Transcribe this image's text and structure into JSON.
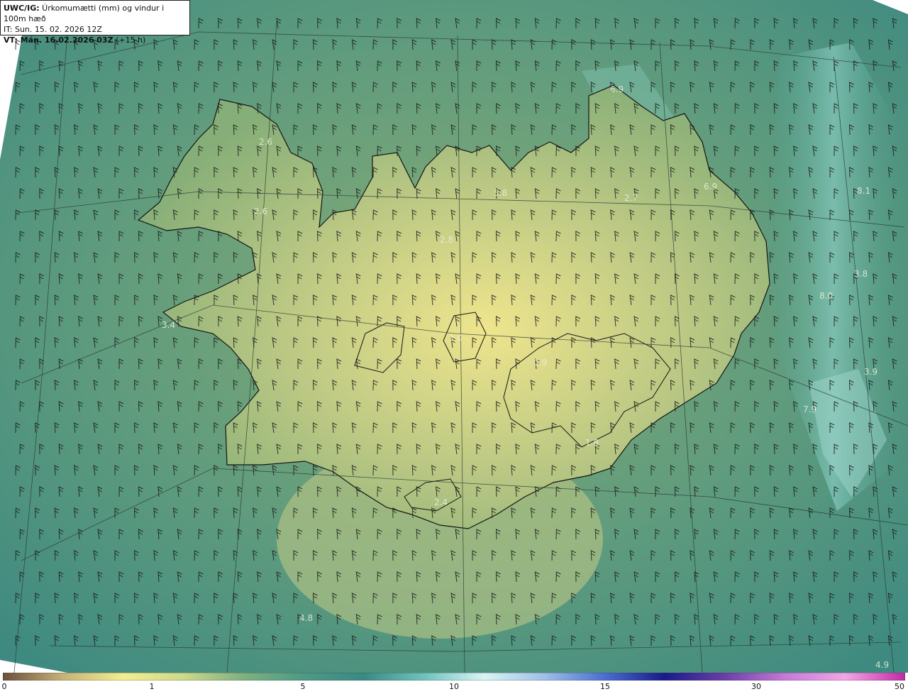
{
  "header": {
    "product": "UWC/IG:",
    "field": " Úrkomumætti (mm) og vindur i 100m hæð",
    "it_line": "IT: Sun. 15. 02. 2026 12Z",
    "vt_label": "VT: Mán. 16.02.2026 03Z",
    "vt_offset": " (+15 h)"
  },
  "map_values": [
    {
      "label": "6.9"
    },
    {
      "label": "2.6"
    },
    {
      "label": "5.8"
    },
    {
      "label": "2.7"
    },
    {
      "label": "6.9"
    },
    {
      "label": "8.1"
    },
    {
      "label": "2.6"
    },
    {
      "label": "2.8"
    },
    {
      "label": "3.8"
    },
    {
      "label": "8.0"
    },
    {
      "label": "3.4"
    },
    {
      "label": "1.0"
    },
    {
      "label": "0.9"
    },
    {
      "label": "3.9"
    },
    {
      "label": "7.9"
    },
    {
      "label": "1.8"
    },
    {
      "label": "2.4"
    },
    {
      "label": "4.8"
    },
    {
      "label": "4.9"
    }
  ],
  "colorbar": {
    "ticks": [
      {
        "label": "0",
        "value": 0
      },
      {
        "label": "1",
        "value": 1
      },
      {
        "label": "5",
        "value": 5
      },
      {
        "label": "10",
        "value": 10
      },
      {
        "label": "15",
        "value": 15
      },
      {
        "label": "30",
        "value": 30
      },
      {
        "label": "50",
        "value": 50
      }
    ],
    "colors": [
      "#6b4f3a",
      "#c7b27a",
      "#f3ee8f",
      "#cdd98c",
      "#7fb07f",
      "#4d9a85",
      "#3a8a84",
      "#6fc2bd",
      "#d9f4f4",
      "#9fc0e8",
      "#4a6fd0",
      "#1a1a8a",
      "#6b3fa8",
      "#c678d8",
      "#f2a6e6",
      "#c22aa6"
    ]
  },
  "colors": {
    "land": "#d4d58a",
    "sea": "#4d9a85",
    "coast": "#1a1a1a"
  }
}
